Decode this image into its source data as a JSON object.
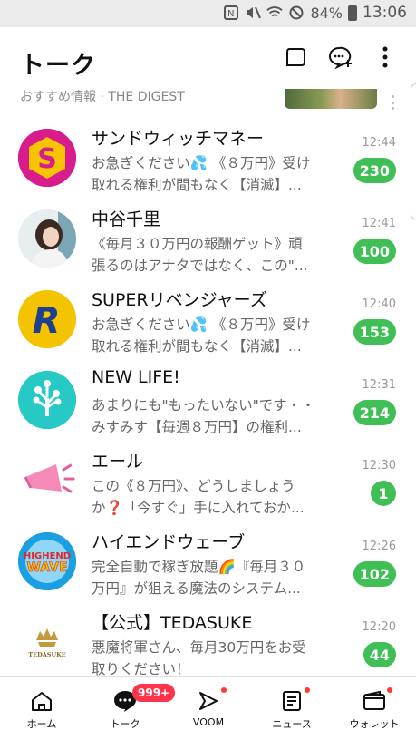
{
  "status_bar": {
    "battery": "84%",
    "time": "13:06"
  },
  "header": {
    "title": "トーク"
  },
  "digest": {
    "label": "おすすめ情報 · THE DIGEST"
  },
  "chats": [
    {
      "name": "サンドウィッチマネー",
      "preview_line1": "お急ぎください💦 《８万円》受け",
      "preview_line2": "取れる権利が間もなく【消滅】...",
      "time": "12:44",
      "unread": "230"
    },
    {
      "name": "中谷千里",
      "preview_line1": "《毎月３０万円の報酬ゲット》頑",
      "preview_line2": "張るのはアナタではなく、この\"...",
      "time": "12:41",
      "unread": "100"
    },
    {
      "name": "SUPERリベンジャーズ",
      "preview_line1": "お急ぎください💦 《８万円》受け",
      "preview_line2": "取れる権利が間もなく【消滅】...",
      "time": "12:40",
      "unread": "153"
    },
    {
      "name": "NEW LIFE!",
      "preview_line1": "あまりにも\"もったいない\"です・・",
      "preview_line2": "みすみす【毎週８万円】の権利...",
      "time": "12:31",
      "unread": "214"
    },
    {
      "name": "エール",
      "preview_line1": "この《８万円》、どうしましょう",
      "preview_line2": "か❓「今すぐ」手に入れておか...",
      "time": "12:30",
      "unread": "1"
    },
    {
      "name": "ハイエンドウェーブ",
      "preview_line1": "完全自動で稼ぎ放題🌈『毎月３０",
      "preview_line2": "万円』が狙える魔法のシステム...",
      "time": "12:26",
      "unread": "102"
    },
    {
      "name": "【公式】TEDASUKE",
      "preview_line1": "悪魔将軍さん、毎月30万円をお受",
      "preview_line2": "取りください！",
      "time": "12:20",
      "unread": "44"
    }
  ],
  "avatars": {
    "s_letter": "S",
    "r_letter": "R",
    "hiend_line1": "HIGHEND",
    "hiend_line2": "WAVE",
    "tedasuke": "TEDASUKE"
  },
  "tabs": [
    {
      "label": "ホーム"
    },
    {
      "label": "トーク",
      "badge": "999+"
    },
    {
      "label": "VOOM"
    },
    {
      "label": "ニュース"
    },
    {
      "label": "ウォレット"
    }
  ],
  "colors": {
    "badge_green": "#3fbf55",
    "notification_red": "#ff334b"
  }
}
